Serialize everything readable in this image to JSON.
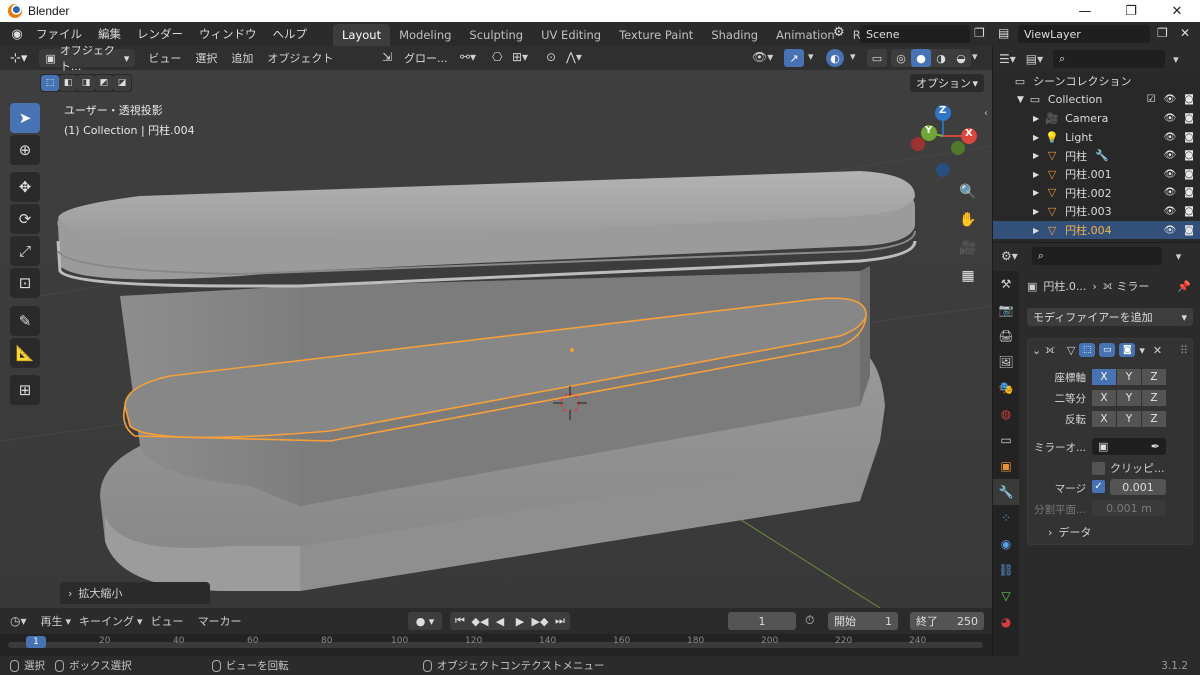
{
  "window": {
    "title": "Blender",
    "minimize": "—",
    "maximize": "❐",
    "close": "✕"
  },
  "topbar": {
    "menus": [
      "ファイル",
      "編集",
      "レンダー",
      "ウィンドウ",
      "ヘルプ"
    ],
    "workspaces": [
      "Layout",
      "Modeling",
      "Sculpting",
      "UV Editing",
      "Texture Paint",
      "Shading",
      "Animation",
      "Rendering"
    ],
    "active_workspace": "Layout",
    "scene": "Scene",
    "view_layer": "ViewLayer"
  },
  "viewport": {
    "mode": "オブジェクト...",
    "menus": [
      "ビュー",
      "選択",
      "追加",
      "オブジェクト"
    ],
    "transform_orientation": "グロー...",
    "options_label": "オプション",
    "overlay_title": "ユーザー・透視投影",
    "overlay_subtitle": "(1) Collection | 円柱.004",
    "last_op": "拡大縮小",
    "gizmo_axes": {
      "z": "Z",
      "y": "Y",
      "x": "X"
    }
  },
  "timeline": {
    "menus": [
      "再生",
      "キーイング",
      "ビュー",
      "マーカー"
    ],
    "current_frame": "1",
    "start_label": "開始",
    "start": "1",
    "end_label": "終了",
    "end": "250",
    "ticks": [
      "1",
      "20",
      "40",
      "60",
      "80",
      "100",
      "120",
      "140",
      "160",
      "180",
      "200",
      "220",
      "240"
    ]
  },
  "outliner": {
    "scene_collection": "シーンコレクション",
    "collection": "Collection",
    "items": [
      {
        "name": "Camera",
        "icon": "camera-icon",
        "selected": false
      },
      {
        "name": "Light",
        "icon": "light-icon",
        "selected": false
      },
      {
        "name": "円柱",
        "icon": "mesh-icon",
        "selected": false
      },
      {
        "name": "円柱.001",
        "icon": "mesh-icon",
        "selected": false
      },
      {
        "name": "円柱.002",
        "icon": "mesh-icon",
        "selected": false
      },
      {
        "name": "円柱.003",
        "icon": "mesh-icon",
        "selected": false
      },
      {
        "name": "円柱.004",
        "icon": "mesh-icon",
        "selected": true
      }
    ]
  },
  "properties": {
    "breadcrumb_object": "円柱.0...",
    "breadcrumb_modifier": "ミラー",
    "add_modifier": "モディファイアーを追加",
    "axis_label": "座標軸",
    "bisect_label": "二等分",
    "flip_label": "反転",
    "xyz": [
      "X",
      "Y",
      "Z"
    ],
    "mirror_object_label": "ミラーオ...",
    "clipping_label": "クリッピ...",
    "merge_label": "マージ",
    "merge_value": "0.001",
    "bisect_distance_label": "分割平面...",
    "bisect_distance_value": "0.001 m",
    "data_label": "データ"
  },
  "statusbar": {
    "select": "選択",
    "box_select": "ボックス選択",
    "rotate_view": "ビューを回転",
    "context_menu": "オブジェクトコンテクストメニュー",
    "version": "3.1.2"
  },
  "colors": {
    "accent": "#4772b3",
    "selection_outline": "#f5a03a",
    "viewport_bg": "#3d3d3d"
  }
}
